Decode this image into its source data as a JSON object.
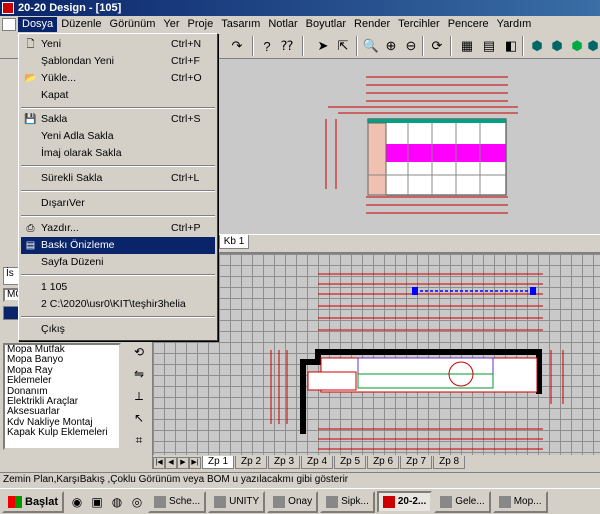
{
  "window": {
    "title": "20-20 Design - [105]"
  },
  "menubar": [
    "Dosya",
    "Düzenle",
    "Görünüm",
    "Yer",
    "Proje",
    "Tasarım",
    "Notlar",
    "Boyutlar",
    "Render",
    "Tercihler",
    "Pencere",
    "Yardım"
  ],
  "file_menu": [
    {
      "label": "Yeni",
      "shortcut": "Ctrl+N"
    },
    {
      "label": "Şablondan Yeni",
      "shortcut": "Ctrl+F"
    },
    {
      "label": "Yükle...",
      "shortcut": "Ctrl+O"
    },
    {
      "label": "Kapat",
      "shortcut": ""
    },
    {
      "label": "Sakla",
      "shortcut": "Ctrl+S"
    },
    {
      "label": "Yeni Adla Sakla",
      "shortcut": ""
    },
    {
      "label": "İmaj olarak Sakla",
      "shortcut": ""
    },
    {
      "label": "Sürekli Sakla",
      "shortcut": "Ctrl+L"
    },
    {
      "label": "DışarıVer",
      "shortcut": ""
    },
    {
      "label": "Yazdır...",
      "shortcut": "Ctrl+P"
    },
    {
      "label": "Baskı Önizleme",
      "shortcut": ""
    },
    {
      "label": "Sayfa Düzeni",
      "shortcut": ""
    },
    {
      "label": "1 105",
      "shortcut": ""
    },
    {
      "label": "2 C:\\2020\\usr0\\KIT\\teşhir3helia",
      "shortcut": ""
    },
    {
      "label": "Çıkış",
      "shortcut": ""
    }
  ],
  "left_panel": {
    "combo_value": "MC",
    "tab_label": "İs",
    "catalog_items": [
      "Mopa Mutfak",
      "Mopa Banyo",
      "Mopa Ray",
      "Eklemeler",
      "Donanım",
      "Elektrikli Araçlar",
      "Aksesuarlar",
      "Kdv Nakliye Montaj",
      "Kapak Kulp Eklemeleri"
    ]
  },
  "view_tabs": {
    "top": "Kb 1",
    "bottom": [
      "Zp 1",
      "Zp 2",
      "Zp 3",
      "Zp 4",
      "Zp 5",
      "Zp 6",
      "Zp 7",
      "Zp 8"
    ]
  },
  "status_text": "Zemin Plan,KarşıBakış ,Çoklu Görünüm veya BOM u yazılacakmı gibi gösterir",
  "taskbar": {
    "start_label": "Başlat",
    "tasks": [
      "Sche...",
      "UNITY",
      "Onay",
      "Sipk...",
      "20-2...",
      "Gele...",
      "Mop..."
    ]
  },
  "colors": {
    "title_bar": "#0a246a",
    "highlight": "#0a246a",
    "drawing_red": "#cc0000",
    "drawing_magenta": "#ff00ff"
  }
}
